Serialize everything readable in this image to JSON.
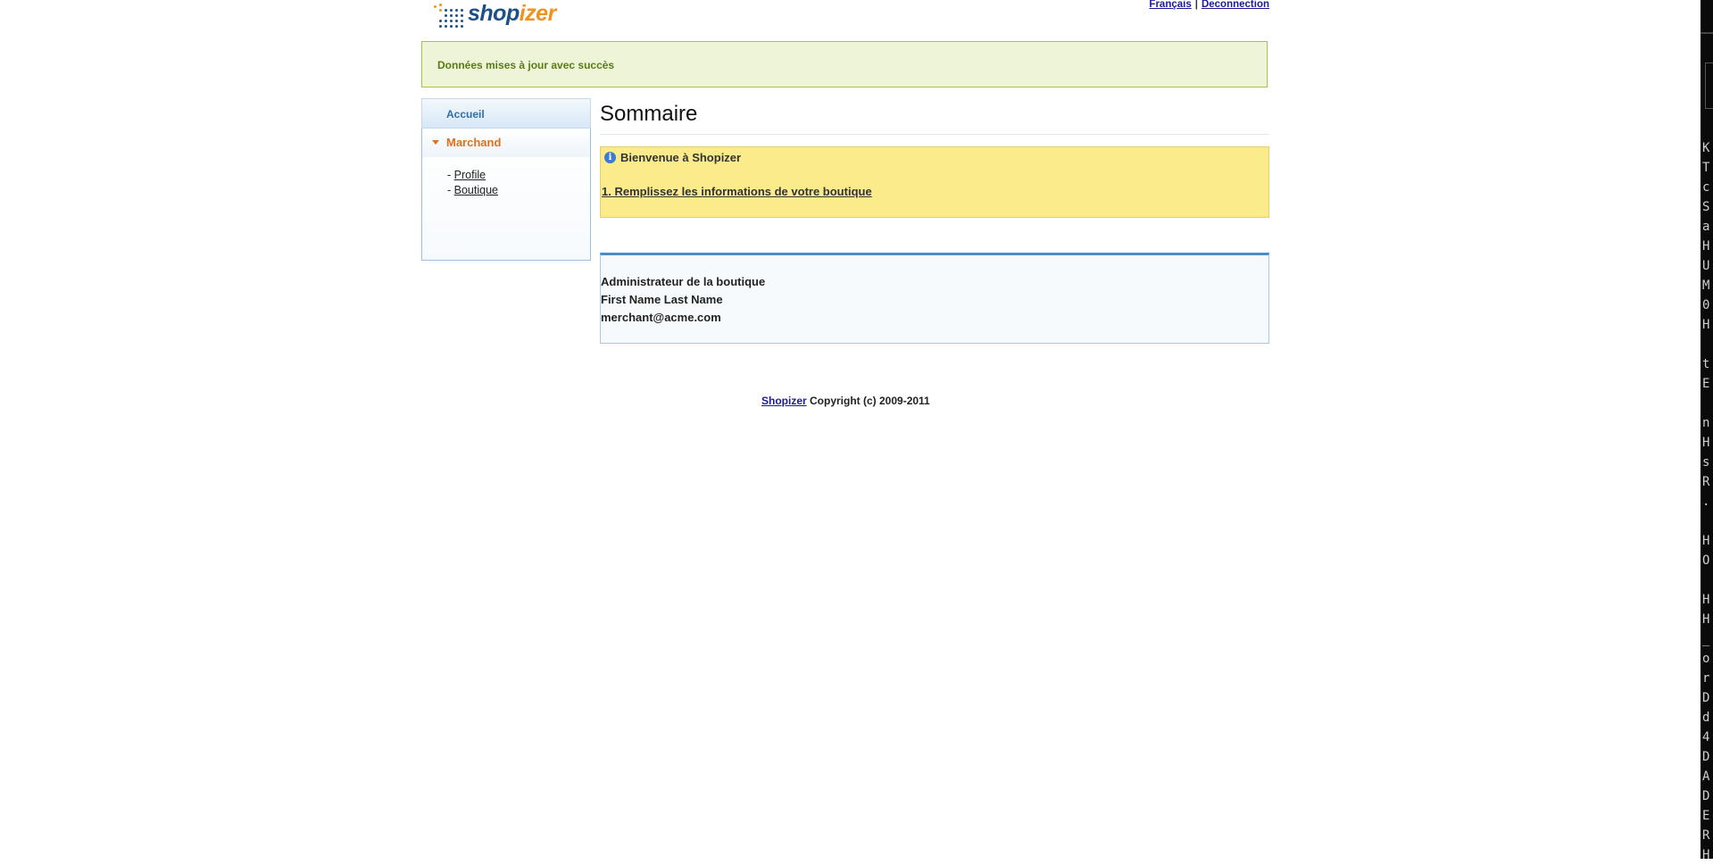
{
  "header": {
    "logo_shop": "shop",
    "logo_izer": "izer",
    "lang_link": "Français",
    "separator": "|",
    "logout_link": "Deconnection"
  },
  "success_message": "Données mises à jour avec succès",
  "sidebar": {
    "home": "Accueil",
    "merchant": "Marchand",
    "items": [
      {
        "prefix": "- ",
        "label": "Profile"
      },
      {
        "prefix": "- ",
        "label": "Boutique"
      }
    ]
  },
  "main": {
    "title": "Sommaire",
    "notice": {
      "icon": "i",
      "heading": "Bienvenue à Shopizer",
      "link": "1. Remplissez les informations de votre boutique"
    },
    "admin": {
      "heading": "Administrateur de la boutique",
      "name": "First Name Last Name",
      "email": "merchant@acme.com"
    }
  },
  "footer": {
    "link": "Shopizer",
    "text": " Copyright (c) 2009-2011"
  },
  "terminal_chars": [
    "K",
    "T",
    "c",
    "S",
    "a",
    "H",
    "U",
    "M",
    "0",
    "H",
    "",
    "t",
    "E",
    "",
    "n",
    "H",
    "s",
    "R",
    ".",
    "",
    "H",
    "O",
    "",
    "H",
    "H",
    "_",
    "o",
    "r",
    "D",
    "d",
    "4",
    "D",
    "A",
    "D",
    "E",
    "R",
    "H"
  ],
  "colors": {
    "brand_blue": "#1d4f8a",
    "brand_orange": "#f0931e",
    "success_bg": "#eef4d8",
    "notice_bg": "#fbeb8b",
    "merchant_orange": "#e27116"
  }
}
